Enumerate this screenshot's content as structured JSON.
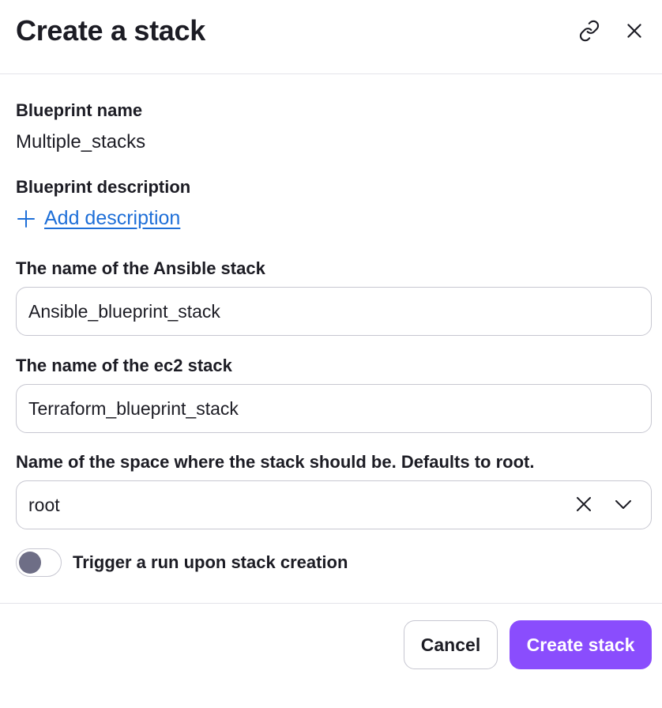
{
  "dialog": {
    "title": "Create a stack"
  },
  "icons": {
    "link": "link-icon",
    "close": "close-icon",
    "plus": "plus-icon",
    "clear": "clear-icon",
    "chevron": "chevron-down-icon"
  },
  "fields": {
    "blueprint_name_label": "Blueprint name",
    "blueprint_name_value": "Multiple_stacks",
    "blueprint_description_label": "Blueprint description",
    "add_description_label": "Add description",
    "ansible_stack_label": "The name of the Ansible stack",
    "ansible_stack_value": "Ansible_blueprint_stack",
    "ec2_stack_label": "The name of the ec2 stack",
    "ec2_stack_value": "Terraform_blueprint_stack",
    "space_label": "Name of the space where the stack should be. Defaults to root.",
    "space_value": "root",
    "trigger_label": "Trigger a run upon stack creation",
    "trigger_enabled": false
  },
  "footer": {
    "cancel_label": "Cancel",
    "create_label": "Create stack"
  },
  "colors": {
    "accent": "#8a4dfd",
    "link": "#1e6fd8",
    "text": "#1c1c24",
    "border": "#c7c7d1"
  }
}
